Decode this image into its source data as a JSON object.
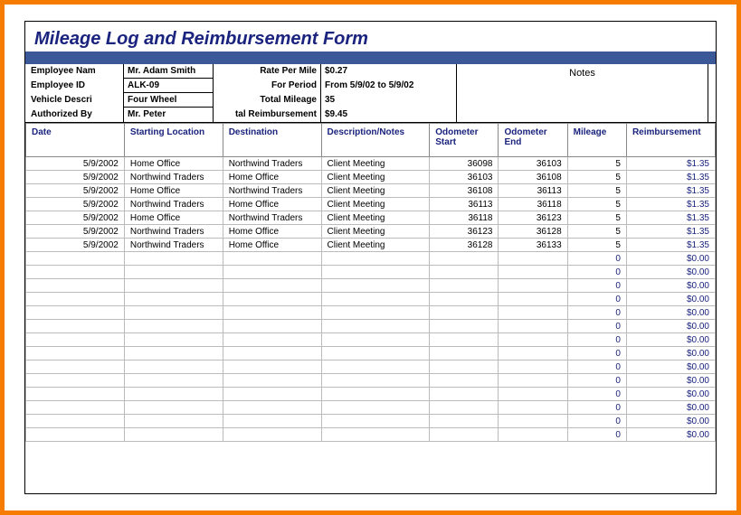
{
  "title": "Mileage Log and Reimbursement Form",
  "labels": {
    "employee_name": "Employee Nam",
    "employee_id": "Employee ID",
    "vehicle_desc": "Vehicle Descri",
    "authorized_by": "Authorized By",
    "rate_per_mile": "Rate Per Mile",
    "for_period": "For Period",
    "total_mileage": "Total Mileage",
    "total_reimbursement": "tal Reimbursement",
    "notes": "Notes"
  },
  "employee": {
    "name": "Mr. Adam Smith",
    "id": "ALK-09",
    "vehicle": "Four Wheel",
    "authorized_by": "Mr. Peter"
  },
  "summary": {
    "rate_per_mile": "$0.27",
    "for_period": "From 5/9/02 to 5/9/02",
    "total_mileage": "35",
    "total_reimbursement": "$9.45"
  },
  "columns": {
    "date": "Date",
    "starting_location": "Starting Location",
    "destination": "Destination",
    "description": "Description/Notes",
    "odometer_start": "Odometer Start",
    "odometer_end": "Odometer End",
    "mileage": "Mileage",
    "reimbursement": "Reimbursement"
  },
  "rows": [
    {
      "date": "5/9/2002",
      "start": "Home Office",
      "dest": "Northwind Traders",
      "desc": "Client Meeting",
      "ostart": "36098",
      "oend": "36103",
      "mileage": "5",
      "reimb": "$1.35"
    },
    {
      "date": "5/9/2002",
      "start": "Northwind Traders",
      "dest": "Home Office",
      "desc": "Client Meeting",
      "ostart": "36103",
      "oend": "36108",
      "mileage": "5",
      "reimb": "$1.35"
    },
    {
      "date": "5/9/2002",
      "start": "Home Office",
      "dest": "Northwind Traders",
      "desc": "Client Meeting",
      "ostart": "36108",
      "oend": "36113",
      "mileage": "5",
      "reimb": "$1.35"
    },
    {
      "date": "5/9/2002",
      "start": "Northwind Traders",
      "dest": "Home Office",
      "desc": "Client Meeting",
      "ostart": "36113",
      "oend": "36118",
      "mileage": "5",
      "reimb": "$1.35"
    },
    {
      "date": "5/9/2002",
      "start": "Home Office",
      "dest": "Northwind Traders",
      "desc": "Client Meeting",
      "ostart": "36118",
      "oend": "36123",
      "mileage": "5",
      "reimb": "$1.35"
    },
    {
      "date": "5/9/2002",
      "start": "Northwind Traders",
      "dest": "Home Office",
      "desc": "Client Meeting",
      "ostart": "36123",
      "oend": "36128",
      "mileage": "5",
      "reimb": "$1.35"
    },
    {
      "date": "5/9/2002",
      "start": "Northwind Traders",
      "dest": "Home Office",
      "desc": "Client Meeting",
      "ostart": "36128",
      "oend": "36133",
      "mileage": "5",
      "reimb": "$1.35"
    }
  ],
  "empty_rows": [
    {
      "mileage": "0",
      "reimb": "$0.00"
    },
    {
      "mileage": "0",
      "reimb": "$0.00"
    },
    {
      "mileage": "0",
      "reimb": "$0.00"
    },
    {
      "mileage": "0",
      "reimb": "$0.00"
    },
    {
      "mileage": "0",
      "reimb": "$0.00"
    },
    {
      "mileage": "0",
      "reimb": "$0.00"
    },
    {
      "mileage": "0",
      "reimb": "$0.00"
    },
    {
      "mileage": "0",
      "reimb": "$0.00"
    },
    {
      "mileage": "0",
      "reimb": "$0.00"
    },
    {
      "mileage": "0",
      "reimb": "$0.00"
    },
    {
      "mileage": "0",
      "reimb": "$0.00"
    },
    {
      "mileage": "0",
      "reimb": "$0.00"
    },
    {
      "mileage": "0",
      "reimb": "$0.00"
    },
    {
      "mileage": "0",
      "reimb": "$0.00"
    }
  ]
}
